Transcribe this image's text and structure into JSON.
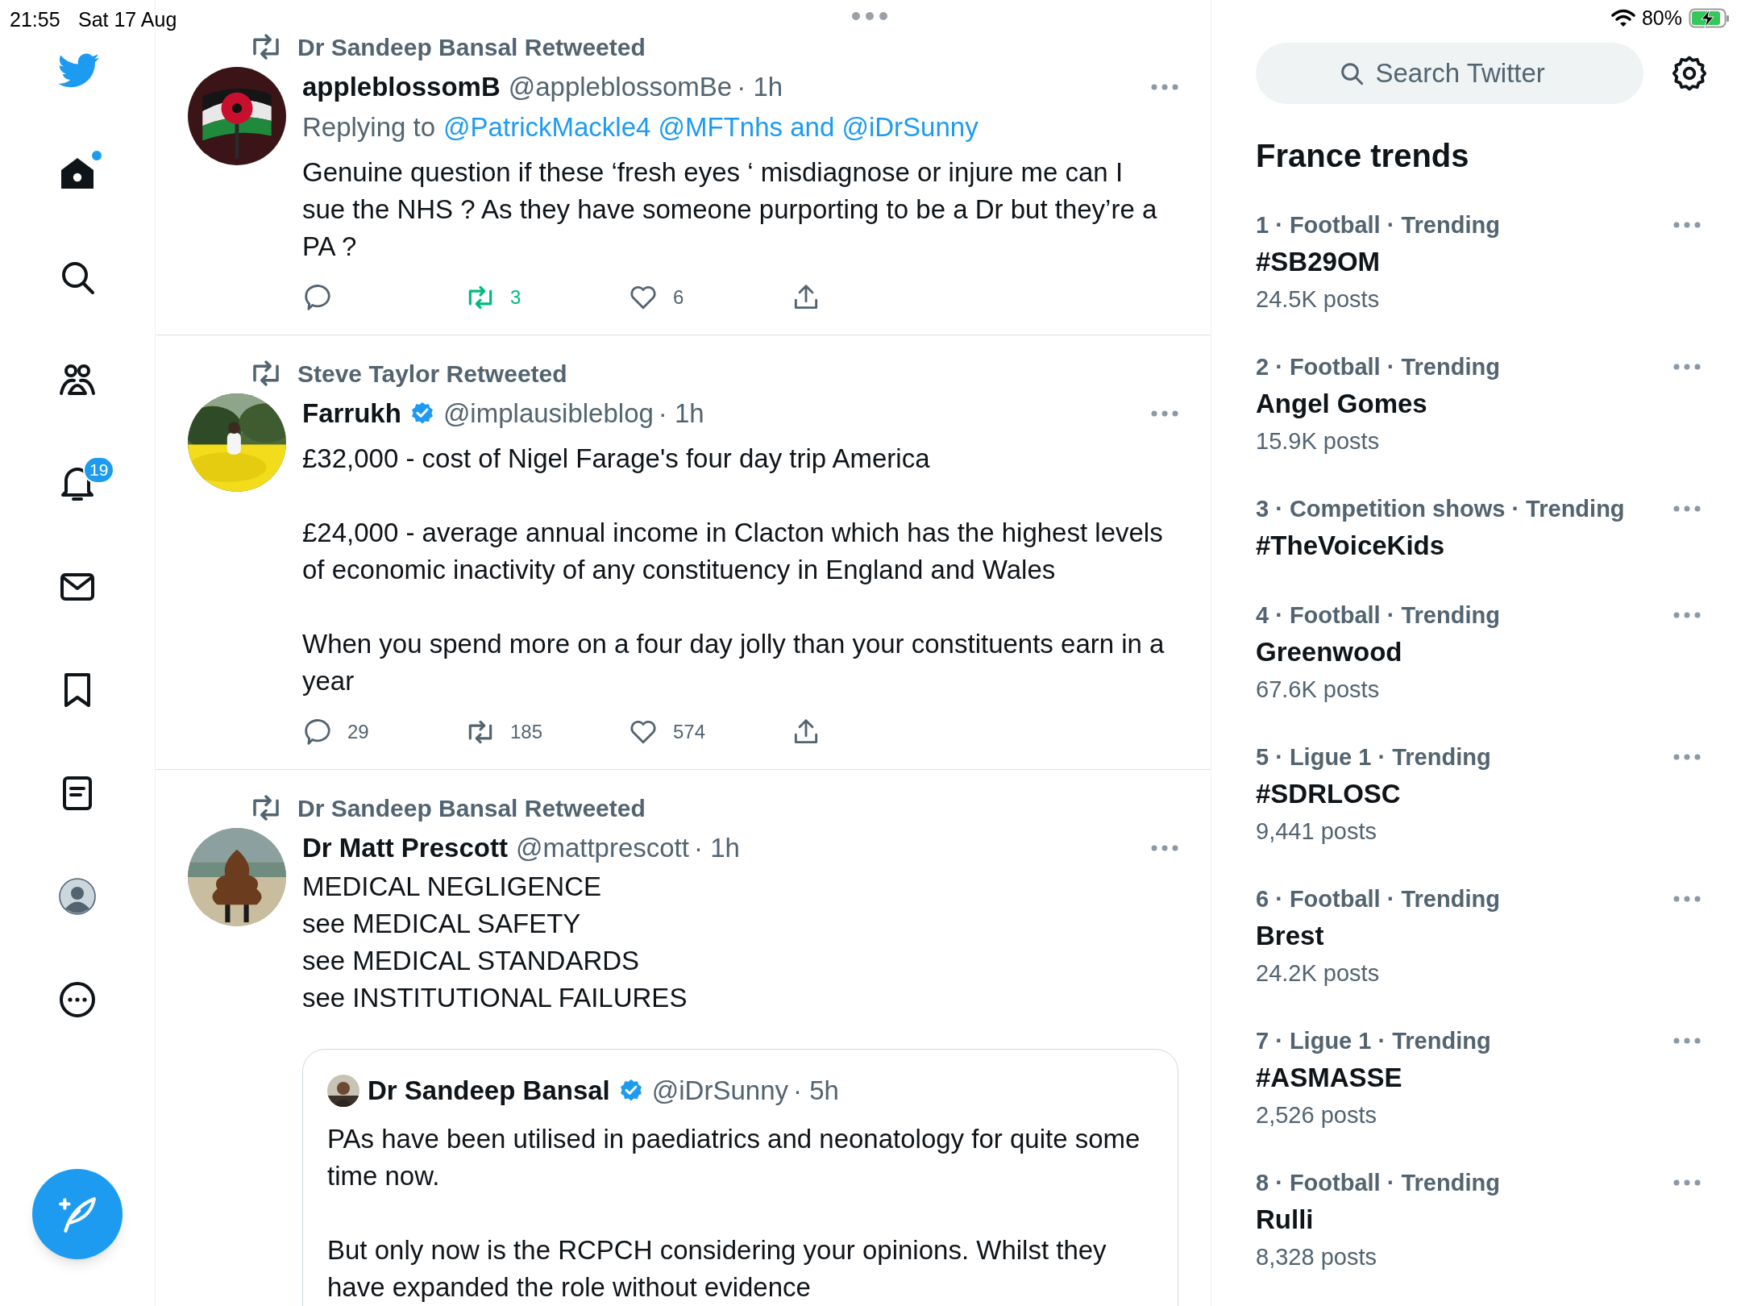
{
  "status_bar": {
    "time": "21:55",
    "date": "Sat 17 Aug",
    "battery": "80%",
    "charging": true
  },
  "nav": [
    {
      "kind": "home",
      "selected": true,
      "has_new": true
    },
    {
      "kind": "search",
      "selected": false
    },
    {
      "kind": "communities",
      "selected": false
    },
    {
      "kind": "notifications",
      "selected": false,
      "badge": "19"
    },
    {
      "kind": "messages",
      "selected": false
    },
    {
      "kind": "bookmarks",
      "selected": false
    },
    {
      "kind": "lists",
      "selected": false
    },
    {
      "kind": "profile",
      "selected": false
    },
    {
      "kind": "more",
      "selected": false
    }
  ],
  "tweets": [
    {
      "retweeted_by": "Dr Sandeep Bansal Retweeted",
      "name": "appleblossomB",
      "verified": false,
      "handle": "@appleblossomBe",
      "time": "· 1h",
      "replying_prefix": "Replying to",
      "replying_to": "@PatrickMackle4 @MFTnhs and @iDrSunny",
      "body": [
        "Genuine question if these ‘fresh eyes ‘ misdiagnose or injure me can I sue the NHS ? As they have someone purporting to be a Dr but they’re a PA ?"
      ],
      "retweets": "3",
      "retweeted": true,
      "likes": "6"
    },
    {
      "retweeted_by": "Steve Taylor Retweeted",
      "name": "Farrukh",
      "verified": true,
      "handle": "@implausibleblog",
      "time": "· 1h",
      "body": [
        "£32,000 - cost of Nigel Farage's four day trip America",
        "£24,000 - average annual income in Clacton which has the highest levels of economic inactivity of any constituency in England and Wales",
        "When you spend more on a four day jolly than your constituents earn in a year"
      ],
      "replies": "29",
      "retweets": "185",
      "retweeted": false,
      "likes": "574"
    },
    {
      "retweeted_by": "Dr Sandeep Bansal Retweeted",
      "name": "Dr Matt Prescott",
      "verified": false,
      "handle": "@mattprescott",
      "time": "· 1h",
      "lines": [
        "MEDICAL NEGLIGENCE",
        "see MEDICAL SAFETY",
        "see MEDICAL STANDARDS",
        "see INSTITUTIONAL FAILURES"
      ],
      "quote": {
        "name": "Dr Sandeep Bansal",
        "verified": true,
        "handle": "@iDrSunny",
        "time": "· 5h",
        "body": [
          "PAs have been utilised in paediatrics and neonatology for quite some time now.",
          "But only now is the RCPCH considering your opinions. Whilst they have expanded the role without evidence"
        ]
      }
    }
  ],
  "search": {
    "placeholder": "Search Twitter"
  },
  "trends_title": "France trends",
  "trends": [
    {
      "context": "1 · Football · Trending",
      "topic": "#SB29OM",
      "posts": "24.5K posts"
    },
    {
      "context": "2 · Football · Trending",
      "topic": "Angel Gomes",
      "posts": "15.9K posts"
    },
    {
      "context": "3 · Competition shows · Trending",
      "topic": "#TheVoiceKids"
    },
    {
      "context": "4 · Football · Trending",
      "topic": "Greenwood",
      "posts": "67.6K posts"
    },
    {
      "context": "5 · Ligue 1 · Trending",
      "topic": "#SDRLOSC",
      "posts": "9,441 posts"
    },
    {
      "context": "6 · Football · Trending",
      "topic": "Brest",
      "posts": "24.2K posts"
    },
    {
      "context": "7 · Ligue 1 · Trending",
      "topic": "#ASMASSE",
      "posts": "2,526 posts"
    },
    {
      "context": "8 · Football · Trending",
      "topic": "Rulli",
      "posts": "8,328 posts"
    }
  ]
}
